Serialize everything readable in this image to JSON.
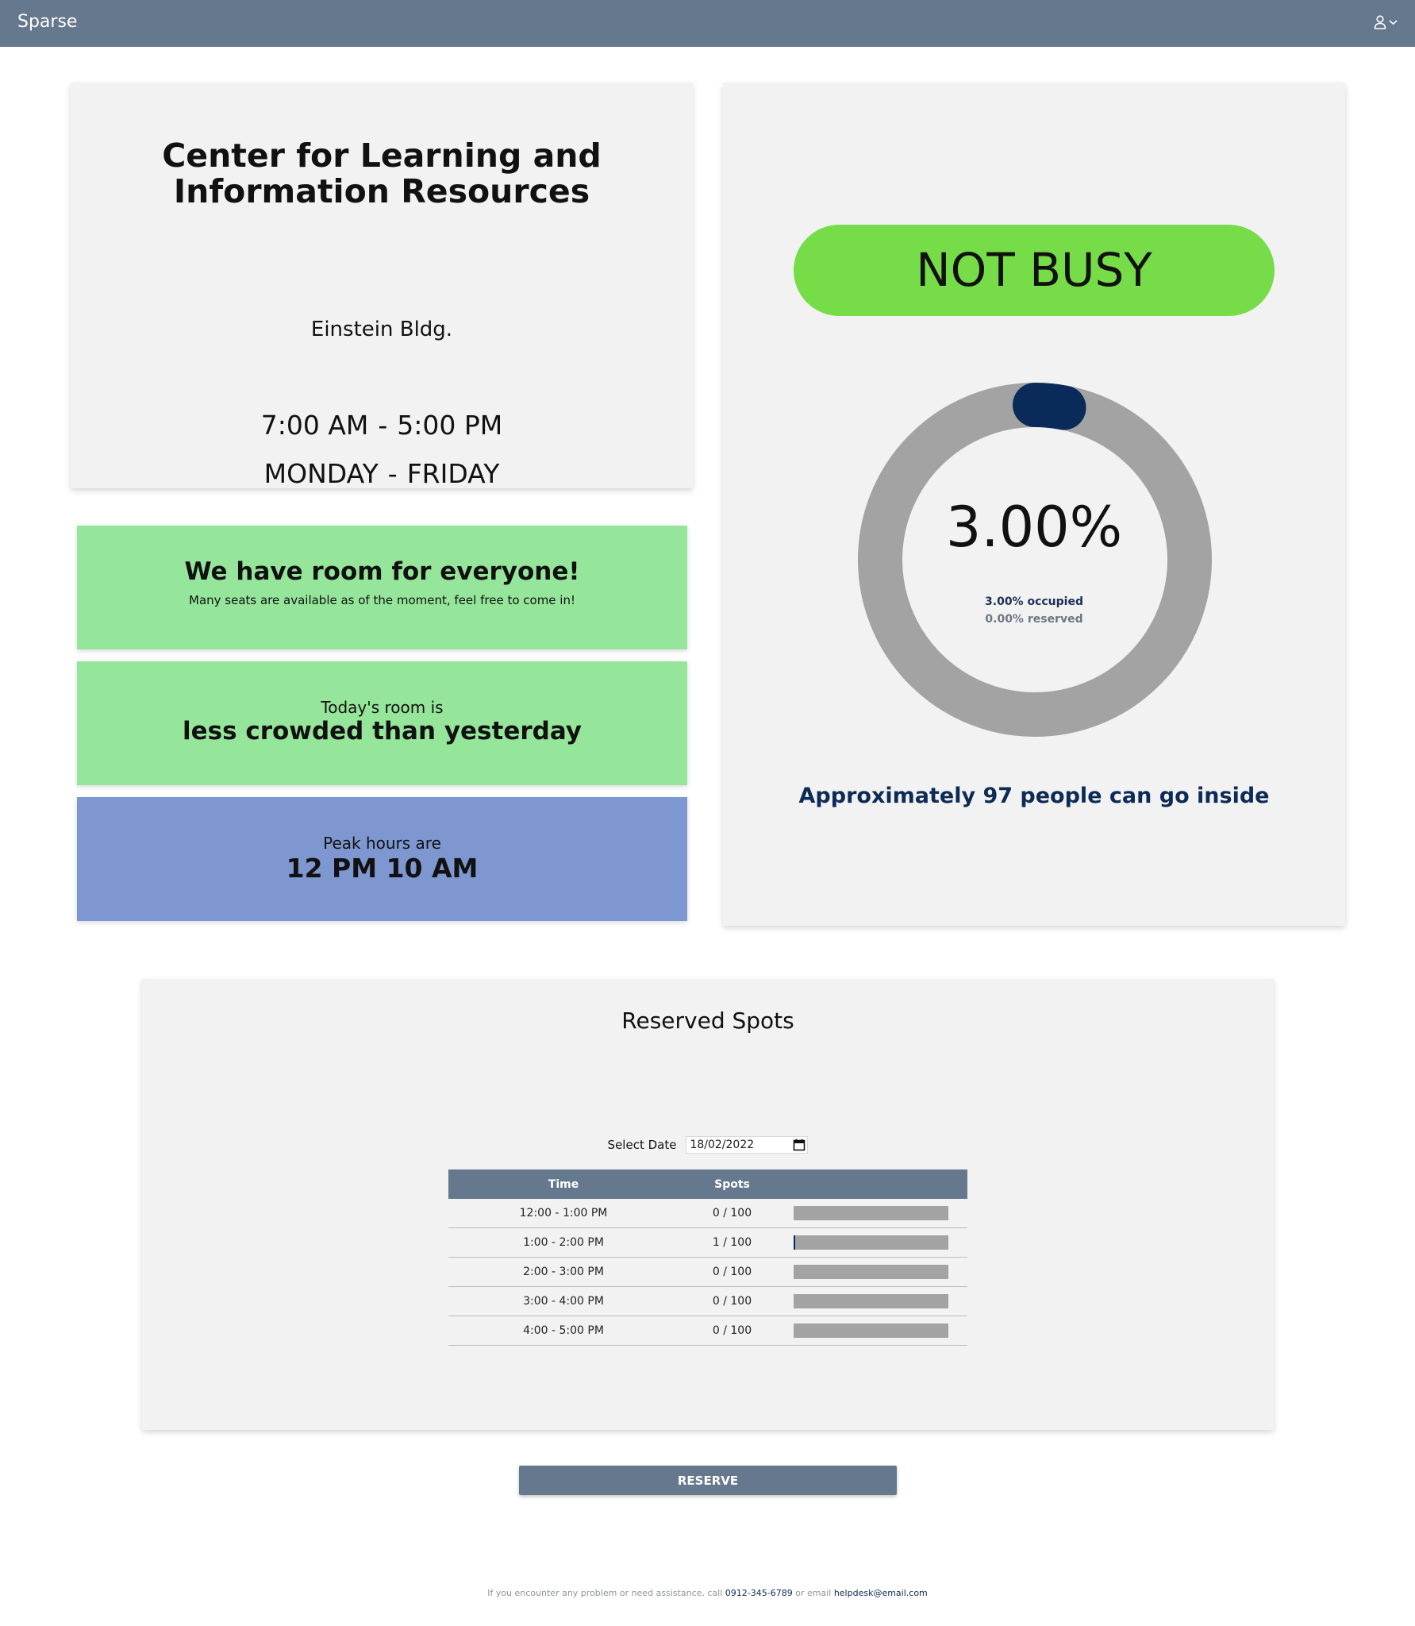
{
  "header": {
    "brand": "Sparse",
    "user_icon": "user-icon",
    "menu_icon": "chevron-down-icon"
  },
  "facility": {
    "name": "Center for Learning and Information Resources",
    "building": "Einstein Bldg.",
    "hours_open": "7:00 AM",
    "hours_close": "5:00 PM",
    "day_start": "MONDAY",
    "day_end": "FRIDAY"
  },
  "banners": {
    "room": {
      "title": "We have room for everyone!",
      "subtitle": "Many seats are available as of the moment, feel free to come in!",
      "color": "#95e59b"
    },
    "crowd": {
      "prefix": "Today's room is",
      "value": "less crowded than yesterday",
      "color": "#95e59b"
    },
    "peak": {
      "prefix": "Peak hours are",
      "value": "12 PM 10 AM",
      "color": "#7e97d1"
    }
  },
  "status": {
    "label": "NOT BUSY",
    "label_color": "#76dd48",
    "percent_text": "3.00%",
    "occupied_text": "3.00% occupied",
    "reserved_text": "0.00% reserved",
    "occupied_fraction": 0.03,
    "reserved_fraction": 0.0,
    "capacity_text": "Approximately 97 people can go inside"
  },
  "reserved": {
    "title": "Reserved Spots",
    "date_label": "Select Date",
    "date_value": "18/02/2022",
    "calendar_icon": "calendar-icon",
    "headers": [
      "Time",
      "Spots"
    ],
    "rows": [
      {
        "time": "12:00 - 1:00 PM",
        "spots": "0 / 100",
        "fill": 0.0
      },
      {
        "time": "1:00 - 2:00 PM",
        "spots": "1 / 100",
        "fill": 0.01
      },
      {
        "time": "2:00 - 3:00 PM",
        "spots": "0 / 100",
        "fill": 0.0
      },
      {
        "time": "3:00 - 4:00 PM",
        "spots": "0 / 100",
        "fill": 0.0
      },
      {
        "time": "4:00 - 5:00 PM",
        "spots": "0 / 100",
        "fill": 0.0
      }
    ]
  },
  "actions": {
    "reserve_label": "RESERVE"
  },
  "footer": {
    "text_before": "If you encounter any problem or need assistance, call",
    "phone": "0912-345-6789",
    "text_middle": "or email",
    "email": "helpdesk@email.com"
  },
  "colors": {
    "accent": "#65788d",
    "occupied": "#0a2a5a",
    "track": "#a3a3a3"
  }
}
